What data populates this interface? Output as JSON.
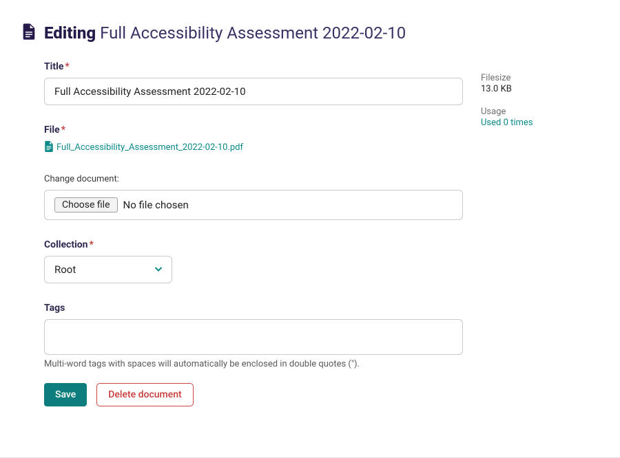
{
  "header": {
    "editing_label": "Editing",
    "title": "Full Accessibility Assessment 2022-02-10"
  },
  "fields": {
    "title": {
      "label": "Title",
      "value": "Full Accessibility Assessment 2022-02-10"
    },
    "file": {
      "label": "File",
      "filename": "Full_Accessibility_Assessment_2022-02-10.pdf",
      "change_label": "Change document:",
      "choose_button_label": "Choose file",
      "no_file_text": "No file chosen"
    },
    "collection": {
      "label": "Collection",
      "value": "Root",
      "options": [
        "Root"
      ]
    },
    "tags": {
      "label": "Tags",
      "value": "",
      "help": "Multi-word tags with spaces will automatically be enclosed in double quotes (\")."
    }
  },
  "buttons": {
    "save": "Save",
    "delete": "Delete document"
  },
  "sidebar": {
    "filesize_label": "Filesize",
    "filesize_value": "13.0 KB",
    "usage_label": "Usage",
    "usage_link": "Used 0 times"
  },
  "colors": {
    "heading": "#261a4a",
    "teal": "#0b8a8a",
    "danger": "#c93b3b"
  }
}
